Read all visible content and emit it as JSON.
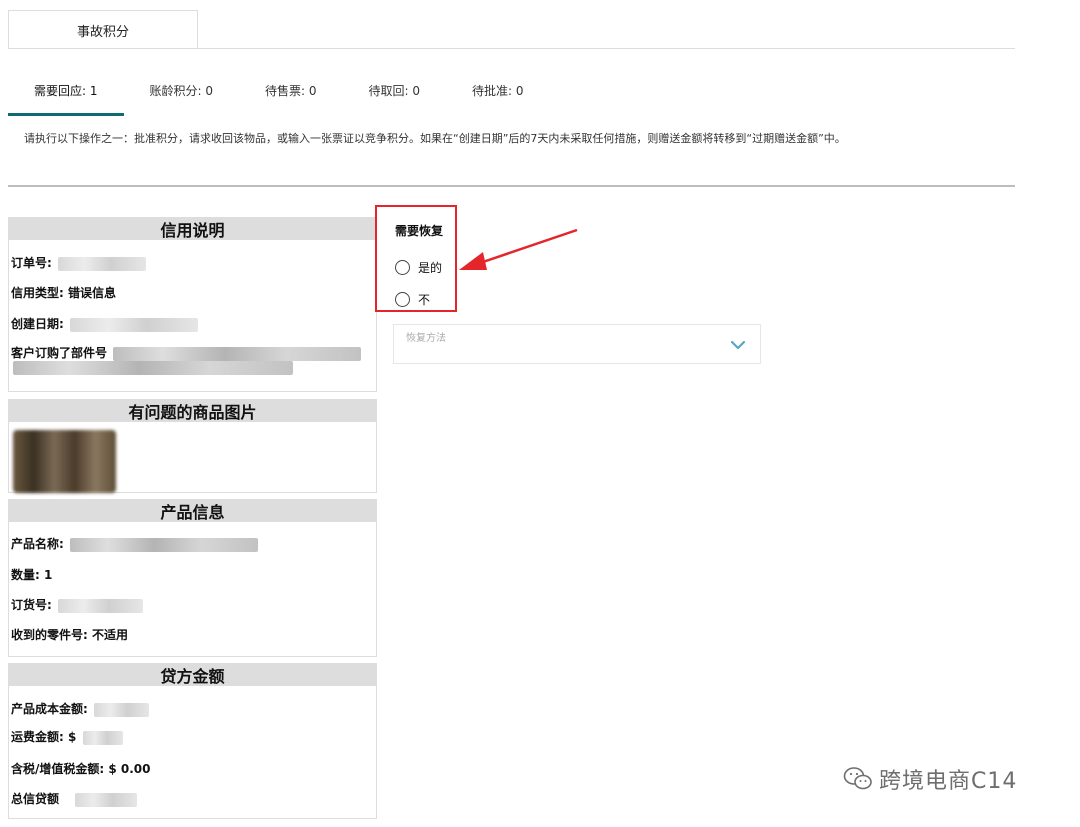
{
  "header": {
    "tab_title": "事故积分"
  },
  "status_tabs": [
    {
      "label": "需要回应: 1",
      "active": true
    },
    {
      "label": "账龄积分: 0",
      "active": false
    },
    {
      "label": "待售票: 0",
      "active": false
    },
    {
      "label": "待取回: 0",
      "active": false
    },
    {
      "label": "待批准: 0",
      "active": false
    }
  ],
  "instruction": "请执行以下操作之一：批准积分，请求收回该物品，或输入一张票证以竞争积分。如果在“创建日期”后的7天内未采取任何措施，则赠送金额将转移到“过期赠送金额”中。",
  "credit_panel": {
    "title": "信用说明",
    "order_no_label": "订单号:",
    "credit_type_label": "信用类型:",
    "credit_type_value": "错误信息",
    "created_date_label": "创建日期:",
    "customer_part_label": "客户订购了部件号"
  },
  "image_panel": {
    "title": "有问题的商品图片"
  },
  "product_panel": {
    "title": "产品信息",
    "name_label": "产品名称:",
    "qty_label": "数量:",
    "qty_value": "1",
    "order_label": "订货号:",
    "received_part_label": "收到的零件号:",
    "received_part_value": "不适用"
  },
  "credit_amount_panel": {
    "title": "贷方金额",
    "cost_label": "产品成本金额:",
    "shipping_label": "运费金额:",
    "shipping_prefix": "$",
    "tax_label": "含税/增值税金额:",
    "tax_value": "$ 0.00",
    "total_label": "总信贷额"
  },
  "recovery": {
    "title": "需要恢复",
    "options": [
      "是的",
      "不"
    ],
    "method_placeholder": "恢复方法"
  },
  "watermark": {
    "text": "跨境电商C14"
  },
  "colors": {
    "accent": "#0f6b72",
    "highlight": "#e4262b"
  }
}
